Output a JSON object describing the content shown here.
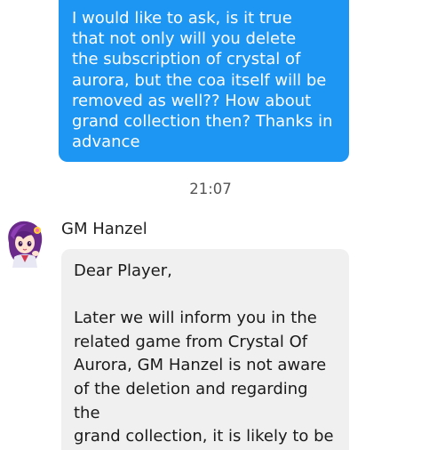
{
  "conversation": {
    "outgoing_message": "I would like to ask, is it true\nthat not only will you delete\nthe subscription of crystal of\naurora, but the coa itself will be\nremoved as well?? How about\ngrand collection then? Thanks in\nadvance",
    "timestamp": "21:07",
    "incoming": {
      "sender_name": "GM Hanzel",
      "avatar_icon": "anime-character-avatar-icon",
      "message": "Dear Player,\n\nLater we will inform you in the\nrelated game from Crystal Of\nAurora, GM Hanzel is not aware\nof the deletion and regarding the\ngrand collection, it is likely to be\nchanged."
    }
  },
  "colors": {
    "outgoing_bubble": "#1d96f3",
    "incoming_bubble": "#f0f0f0",
    "timestamp_text": "#555555"
  }
}
